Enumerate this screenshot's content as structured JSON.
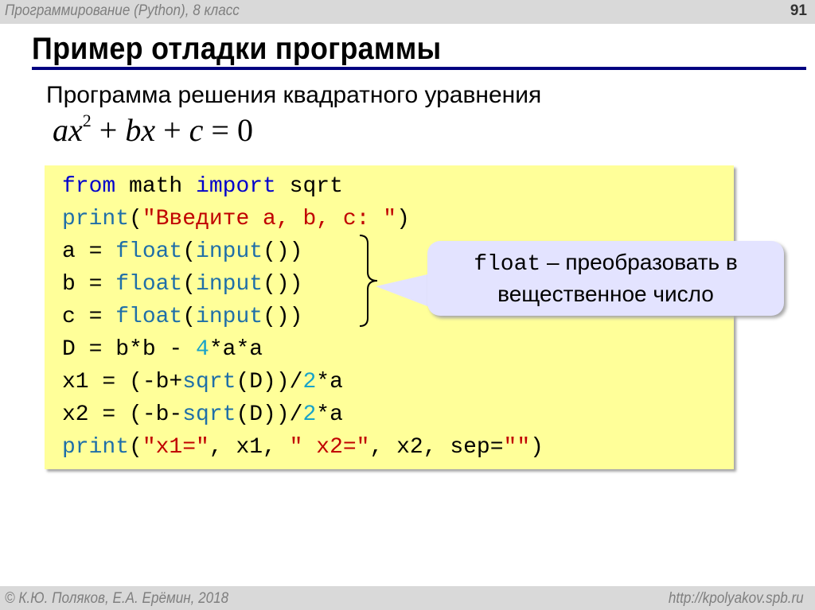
{
  "header": {
    "course": "Программирование (Python), 8 класс",
    "page_number": "91"
  },
  "slide": {
    "title": "Пример отладки программы",
    "subtitle": "Программа решения квадратного уравнения",
    "formula": {
      "a": "a",
      "x1": "x",
      "exp": "2",
      "plus1": " + ",
      "b": "b",
      "x2": "x",
      "plus2": " + ",
      "c": "c",
      "eq": " = ",
      "zero": "0"
    }
  },
  "code": {
    "lines": [
      [
        {
          "t": "from",
          "c": "kw"
        },
        {
          "t": " math ",
          "c": ""
        },
        {
          "t": "import",
          "c": "kw"
        },
        {
          "t": " sqrt",
          "c": ""
        }
      ],
      [
        {
          "t": "print",
          "c": "fn"
        },
        {
          "t": "(",
          "c": ""
        },
        {
          "t": "\"Введите a, b, c: \"",
          "c": "str"
        },
        {
          "t": ")",
          "c": ""
        }
      ],
      [
        {
          "t": "a = ",
          "c": ""
        },
        {
          "t": "float",
          "c": "fn"
        },
        {
          "t": "(",
          "c": ""
        },
        {
          "t": "input",
          "c": "fn"
        },
        {
          "t": "())",
          "c": ""
        }
      ],
      [
        {
          "t": "b = ",
          "c": ""
        },
        {
          "t": "float",
          "c": "fn"
        },
        {
          "t": "(",
          "c": ""
        },
        {
          "t": "input",
          "c": "fn"
        },
        {
          "t": "())",
          "c": ""
        }
      ],
      [
        {
          "t": "c = ",
          "c": ""
        },
        {
          "t": "float",
          "c": "fn"
        },
        {
          "t": "(",
          "c": ""
        },
        {
          "t": "input",
          "c": "fn"
        },
        {
          "t": "())",
          "c": ""
        }
      ],
      [
        {
          "t": "D = b*b - ",
          "c": ""
        },
        {
          "t": "4",
          "c": "num"
        },
        {
          "t": "*a*a",
          "c": ""
        }
      ],
      [
        {
          "t": "x1 = (-b+",
          "c": ""
        },
        {
          "t": "sqrt",
          "c": "fn"
        },
        {
          "t": "(D))/",
          "c": ""
        },
        {
          "t": "2",
          "c": "num"
        },
        {
          "t": "*a",
          "c": ""
        }
      ],
      [
        {
          "t": "x2 = (-b-",
          "c": ""
        },
        {
          "t": "sqrt",
          "c": "fn"
        },
        {
          "t": "(D))/",
          "c": ""
        },
        {
          "t": "2",
          "c": "num"
        },
        {
          "t": "*a",
          "c": ""
        }
      ],
      [
        {
          "t": "print",
          "c": "fn"
        },
        {
          "t": "(",
          "c": ""
        },
        {
          "t": "\"x1=\"",
          "c": "str"
        },
        {
          "t": ", x1, ",
          "c": ""
        },
        {
          "t": "\" x2=\"",
          "c": "str"
        },
        {
          "t": ", x2, sep=",
          "c": ""
        },
        {
          "t": "\"\"",
          "c": "str"
        },
        {
          "t": ")",
          "c": ""
        }
      ]
    ]
  },
  "callout": {
    "code_word": "float",
    "line1_rest": " – преобразовать в",
    "line2": "вещественное число"
  },
  "footer": {
    "copyright": "© К.Ю. Поляков, Е.А. Ерёмин, 2018",
    "url": "http://kpolyakov.spb.ru"
  },
  "colors": {
    "code_bg": "#ffff99",
    "callout_bg": "#e3e3ff",
    "title_rule": "#000080",
    "keyword": "#0000cc",
    "function": "#1f6fa8",
    "string": "#c00000",
    "number": "#19a3c9"
  }
}
